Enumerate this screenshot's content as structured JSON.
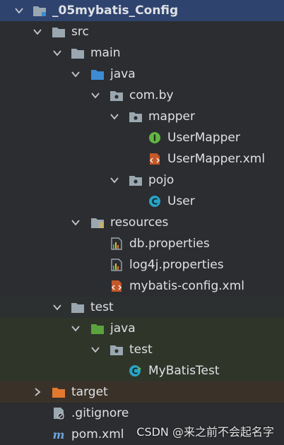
{
  "project_tree": {
    "root": "_05mybatis_Config",
    "src": "src",
    "main": "main",
    "main_java": "java",
    "pkg_com_by": "com.by",
    "mapper": "mapper",
    "user_mapper": "UserMapper",
    "user_mapper_xml": "UserMapper.xml",
    "pojo": "pojo",
    "user": "User",
    "resources": "resources",
    "db_properties": "db.properties",
    "log4j_properties": "log4j.properties",
    "mybatis_config_xml": "mybatis-config.xml",
    "test": "test",
    "test_java": "java",
    "test_pkg": "test",
    "mybatis_test": "MyBatisTest",
    "target": "target",
    "gitignore": ".gitignore",
    "pom_xml": "pom.xml"
  },
  "watermark": "CSDN @来之前不会起名字",
  "colors": {
    "background": "#2b2d30",
    "selected_row": "#2e436e",
    "test_rows": "#2f3529",
    "excluded_row": "#3a3229",
    "folder_gray": "#9aa7b0",
    "source_folder_blue": "#3d8bd3",
    "test_folder_green": "#5aa33c",
    "excluded_folder_orange": "#e2792f",
    "interface_green": "#62b543",
    "class_teal": "#2aa3c4"
  }
}
